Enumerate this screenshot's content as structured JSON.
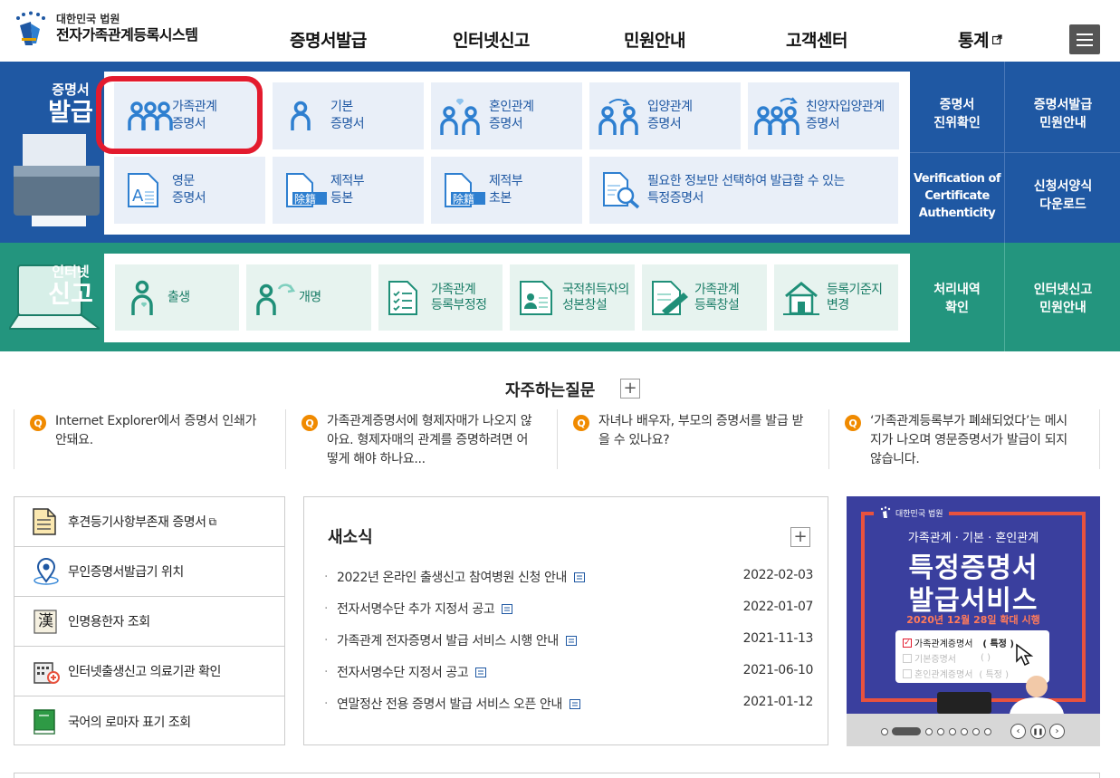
{
  "header": {
    "logo_top": "대한민국 법원",
    "logo_main": "전자가족관계등록시스템",
    "nav": [
      "증명서발급",
      "인터넷신고",
      "민원안내",
      "고객센터",
      "통계"
    ]
  },
  "cert": {
    "side_title_small": "증명서",
    "side_title_big": "발급",
    "cards": [
      {
        "label": "가족관계\n증명서",
        "icon": "family-icon"
      },
      {
        "label": "기본\n증명서",
        "icon": "person-icon"
      },
      {
        "label": "혼인관계\n증명서",
        "icon": "marriage-icon"
      },
      {
        "label": "입양관계\n증명서",
        "icon": "adoption-icon"
      },
      {
        "label": "친양자입양관계\n증명서",
        "icon": "full-adoption-icon"
      },
      {
        "label": "영문\n증명서",
        "icon": "english-doc-icon"
      },
      {
        "label": "제적부\n등본",
        "icon": "removed-register-icon"
      },
      {
        "label": "제적부\n초본",
        "icon": "removed-register-icon"
      },
      {
        "label": "필요한 정보만 선택하여 발급할 수 있는\n특정증명서",
        "icon": "doc-search-icon"
      }
    ],
    "side_links": [
      "증명서\n진위확인",
      "증명서발급\n민원안내",
      "Verification of\nCertificate\nAuthenticity",
      "신청서양식\n다운로드"
    ],
    "stamp_text": "除籍",
    "highlight_color": "#e31b2e"
  },
  "report": {
    "side_title_small": "인터넷",
    "side_title_big": "신고",
    "cards": [
      {
        "label": "출생",
        "icon": "birth-icon"
      },
      {
        "label": "개명",
        "icon": "rename-icon"
      },
      {
        "label": "가족관계\n등록부정정",
        "icon": "checklist-icon"
      },
      {
        "label": "국적취득자의\n성본창설",
        "icon": "id-card-icon"
      },
      {
        "label": "가족관계\n등록창설",
        "icon": "doc-pen-icon"
      },
      {
        "label": "등록기준지\n변경",
        "icon": "house-icon"
      }
    ],
    "side_links": [
      "처리내역\n확인",
      "인터넷신고\n민원안내"
    ]
  },
  "faq": {
    "title": "자주하는질문",
    "q_mark": "Q",
    "items": [
      "Internet Explorer에서 증명서 인쇄가 안돼요.",
      "가족관계증명서에 형제자매가 나오지 않아요. 형제자매의 관계를 증명하려면 어떻게 해야 하나요...",
      "자녀나 배우자, 부모의 증명서를 발급 받을 수 있나요?",
      "‘가족관계등록부가 폐쇄되었다’는 메시지가 나오며 영문증명서가 발급이 되지 않습니다."
    ]
  },
  "quick_links": [
    {
      "label": "후견등기사항부존재 증명서",
      "icon": "document-icon",
      "external": "⧉"
    },
    {
      "label": "무인증명서발급기 위치",
      "icon": "map-pin-icon"
    },
    {
      "label": "인명용한자 조회",
      "icon": "hanja-book-icon",
      "glyph": "漢"
    },
    {
      "label": "인터넷출생신고 의료기관 확인",
      "icon": "hospital-icon"
    },
    {
      "label": "국어의 로마자 표기 조회",
      "icon": "green-book-icon"
    }
  ],
  "news": {
    "title": "새소식",
    "items": [
      {
        "title": "2022년 온라인 출생신고 참여병원 신청 안내",
        "date": "2022-02-03"
      },
      {
        "title": "전자서명수단 추가 지정서 공고",
        "date": "2022-01-07"
      },
      {
        "title": "가족관계 전자증명서 발급 서비스 시행 안내",
        "date": "2021-11-13"
      },
      {
        "title": "전자서명수단 지정서 공고",
        "date": "2021-06-10"
      },
      {
        "title": "연말정산 전용 증명서 발급 서비스 오픈 안내",
        "date": "2021-01-12"
      }
    ]
  },
  "banner": {
    "org": "대한민국 법원",
    "subtitle": "가족관계 · 기본 · 혼인관계",
    "title1": "특정증명서",
    "title2": "발급서비스",
    "date_line": "2020년 12월 28일 확대 시행",
    "checks": [
      {
        "label": "가족관계증명서",
        "tag": "( 특정 )",
        "checked": true
      },
      {
        "label": "기본증명서",
        "tag": "(       )",
        "checked": false
      },
      {
        "label": "혼인관계증명서",
        "tag": "( 특정 )",
        "checked": false
      }
    ],
    "pause": "❚❚",
    "prev": "‹",
    "next": "›",
    "slides": 7
  }
}
